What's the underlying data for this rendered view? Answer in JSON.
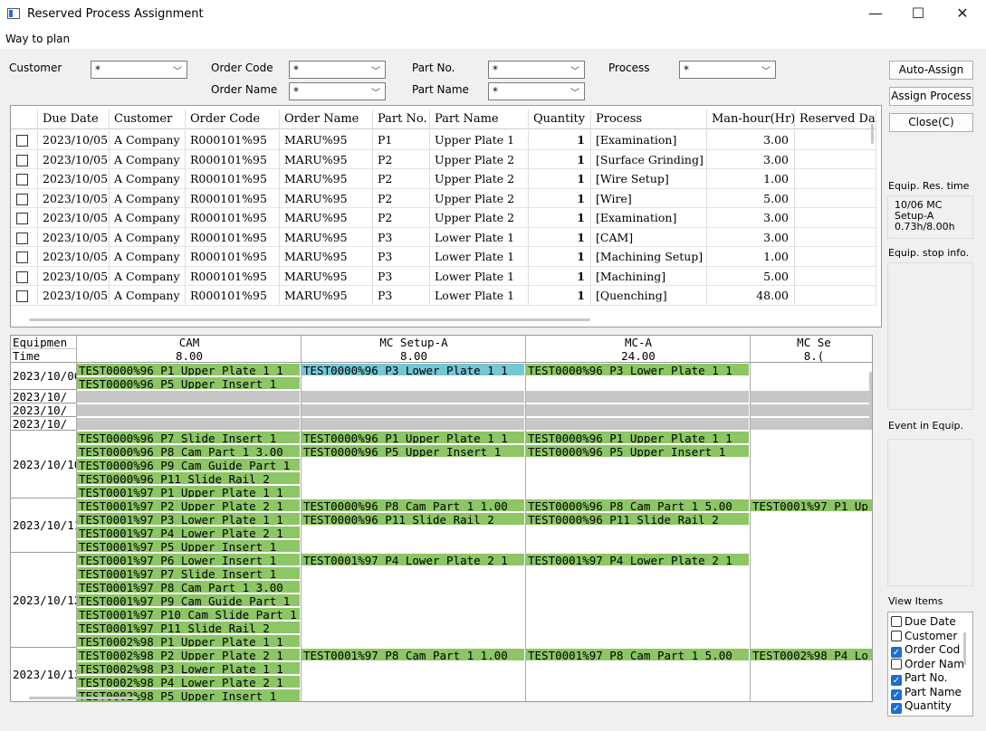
{
  "window": {
    "title": "Reserved Process Assignment",
    "minimize": "—",
    "maximize": "☐",
    "close": "✕"
  },
  "menu": {
    "item": "Way to plan"
  },
  "filters": {
    "customer_label": "Customer",
    "customer_value": "*",
    "order_code_label": "Order Code",
    "order_code_value": "*",
    "order_name_label": "Order Name",
    "order_name_value": "*",
    "part_no_label": "Part No.",
    "part_no_value": "*",
    "part_name_label": "Part Name",
    "part_name_value": "*",
    "process_label": "Process",
    "process_value": "*"
  },
  "buttons": {
    "auto_assign": "Auto-Assign",
    "assign_process": "Assign Process",
    "close": "Close(C)"
  },
  "table": {
    "columns": [
      "Due Date",
      "Customer",
      "Order Code",
      "Order Name",
      "Part No.",
      "Part Name",
      "Quantity",
      "Process",
      "Man-hour(Hr)",
      "Reserved Da"
    ],
    "rows": [
      [
        "2023/10/05",
        "A Company",
        "R000101%95",
        "MARU%95",
        "P1",
        "Upper Plate 1",
        "1",
        "[Examination]",
        "3.00"
      ],
      [
        "2023/10/05",
        "A Company",
        "R000101%95",
        "MARU%95",
        "P2",
        "Upper Plate 2",
        "1",
        "[Surface Grinding]",
        "3.00"
      ],
      [
        "2023/10/05",
        "A Company",
        "R000101%95",
        "MARU%95",
        "P2",
        "Upper Plate 2",
        "1",
        "[Wire Setup]",
        "1.00"
      ],
      [
        "2023/10/05",
        "A Company",
        "R000101%95",
        "MARU%95",
        "P2",
        "Upper Plate 2",
        "1",
        "[Wire]",
        "5.00"
      ],
      [
        "2023/10/05",
        "A Company",
        "R000101%95",
        "MARU%95",
        "P2",
        "Upper Plate 2",
        "1",
        "[Examination]",
        "3.00"
      ],
      [
        "2023/10/05",
        "A Company",
        "R000101%95",
        "MARU%95",
        "P3",
        "Lower Plate 1",
        "1",
        "[CAM]",
        "3.00"
      ],
      [
        "2023/10/05",
        "A Company",
        "R000101%95",
        "MARU%95",
        "P3",
        "Lower Plate 1",
        "1",
        "[Machining Setup]",
        "1.00"
      ],
      [
        "2023/10/05",
        "A Company",
        "R000101%95",
        "MARU%95",
        "P3",
        "Lower Plate 1",
        "1",
        "[Machining]",
        "5.00"
      ],
      [
        "2023/10/05",
        "A Company",
        "R000101%95",
        "MARU%95",
        "P3",
        "Lower Plate 1",
        "1",
        "[Quenching]",
        "48.00"
      ]
    ]
  },
  "schedule": {
    "header_equip": "Equipmen",
    "header_time": "Time",
    "equipment": [
      {
        "name": "CAM",
        "time": "8.00"
      },
      {
        "name": "MC Setup-A",
        "time": "8.00"
      },
      {
        "name": "MC-A",
        "time": "24.00"
      },
      {
        "name": "MC Se",
        "time": "8.("
      }
    ],
    "dates": [
      "2023/10/06",
      "2023/10/",
      "2023/10/",
      "2023/10/",
      "2023/10/10",
      "2023/10/11",
      "2023/10/12",
      "2023/10/13"
    ],
    "cam": [
      "TEST0000%96 P1 Upper Plate 1 1",
      "TEST0000%96 P5 Upper Insert 1",
      "TEST0000%96 P7 Slide Insert 1",
      "TEST0000%96 P8 Cam Part 1  3.00",
      "TEST0000%96 P9 Cam Guide Part 1",
      "TEST0000%96 P11 Slide Rail 2",
      "TEST0001%97 P1 Upper Plate 1 1",
      "TEST0001%97 P2 Upper Plate 2 1",
      "TEST0001%97 P3 Lower Plate 1 1",
      "TEST0001%97 P4 Lower Plate 2 1",
      "TEST0001%97 P5 Upper Insert 1",
      "TEST0001%97 P6 Lower Insert 1",
      "TEST0001%97 P7 Slide Insert 1",
      "TEST0001%97 P8 Cam Part 1  3.00",
      "TEST0001%97 P9 Cam Guide Part 1",
      "TEST0001%97 P10 Cam Slide Part 1",
      "TEST0001%97 P11 Slide Rail 2",
      "TEST0002%98 P1 Upper Plate 1 1",
      "TEST0002%98 P2 Upper Plate 2 1",
      "TEST0002%98 P3 Lower Plate 1 1",
      "TEST0002%98 P4 Lower Plate 2 1",
      "TEST0002%98 P5 Upper Insert 1"
    ],
    "mcsetup": [
      "TEST0000%96 P3 Lower Plate 1 1",
      "TEST0000%96 P1 Upper Plate 1 1",
      "TEST0000%96 P5 Upper Insert 1",
      "TEST0000%96 P8 Cam Part 1  1.00",
      "TEST0000%96 P11 Slide Rail 2",
      "TEST0001%97 P4 Lower Plate 2 1",
      "TEST0001%97 P8 Cam Part 1  1.00"
    ],
    "mca": [
      "TEST0000%96 P3 Lower Plate 1 1",
      "TEST0000%96 P1 Upper Plate 1 1",
      "TEST0000%96 P5 Upper Insert 1",
      "TEST0000%96 P8 Cam Part 1  5.00",
      "TEST0000%96 P11 Slide Rail 2",
      "TEST0001%97 P4 Lower Plate 2 1",
      "TEST0001%97 P8 Cam Part 1  5.00"
    ],
    "mcse": [
      "TEST0001%97 P1 Up",
      "TEST0002%98 P4 Lo"
    ]
  },
  "side": {
    "equip_res_time": "Equip. Res. time",
    "res_line1": "10/06 MC",
    "res_line2": "Setup-A",
    "res_line3": "0.73h/8.00h",
    "equip_stop_info": "Equip. stop info.",
    "event_in_equip": "Event in Equip.",
    "view_items": "View Items",
    "view_list": [
      {
        "label": "Due Date",
        "checked": false
      },
      {
        "label": "Customer",
        "checked": false
      },
      {
        "label": "Order Cod",
        "checked": true
      },
      {
        "label": "Order Nam",
        "checked": false
      },
      {
        "label": "Part No.",
        "checked": true
      },
      {
        "label": "Part Name",
        "checked": true
      },
      {
        "label": "Quantity",
        "checked": true
      }
    ]
  }
}
